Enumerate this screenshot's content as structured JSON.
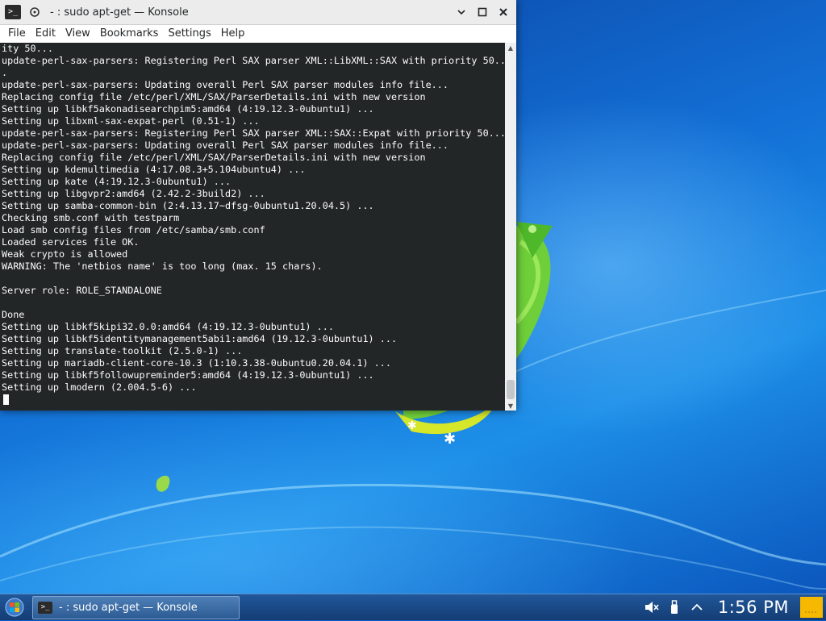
{
  "window": {
    "title": "- : sudo apt-get — Konsole",
    "app_icon_glyph": ">_",
    "menu": [
      "File",
      "Edit",
      "View",
      "Bookmarks",
      "Settings",
      "Help"
    ]
  },
  "terminal": {
    "lines": [
      "ity 50...",
      "update-perl-sax-parsers: Registering Perl SAX parser XML::LibXML::SAX with priority 50..",
      ".",
      "update-perl-sax-parsers: Updating overall Perl SAX parser modules info file...",
      "Replacing config file /etc/perl/XML/SAX/ParserDetails.ini with new version",
      "Setting up libkf5akonadisearchpim5:amd64 (4:19.12.3-0ubuntu1) ...",
      "Setting up libxml-sax-expat-perl (0.51-1) ...",
      "update-perl-sax-parsers: Registering Perl SAX parser XML::SAX::Expat with priority 50...",
      "update-perl-sax-parsers: Updating overall Perl SAX parser modules info file...",
      "Replacing config file /etc/perl/XML/SAX/ParserDetails.ini with new version",
      "Setting up kdemultimedia (4:17.08.3+5.104ubuntu4) ...",
      "Setting up kate (4:19.12.3-0ubuntu1) ...",
      "Setting up libgvpr2:amd64 (2.42.2-3build2) ...",
      "Setting up samba-common-bin (2:4.13.17~dfsg-0ubuntu1.20.04.5) ...",
      "Checking smb.conf with testparm",
      "Load smb config files from /etc/samba/smb.conf",
      "Loaded services file OK.",
      "Weak crypto is allowed",
      "WARNING: The 'netbios name' is too long (max. 15 chars).",
      "",
      "Server role: ROLE_STANDALONE",
      "",
      "Done",
      "Setting up libkf5kipi32.0.0:amd64 (4:19.12.3-0ubuntu1) ...",
      "Setting up libkf5identitymanagement5abi1:amd64 (19.12.3-0ubuntu1) ...",
      "Setting up translate-toolkit (2.5.0-1) ...",
      "Setting up mariadb-client-core-10.3 (1:10.3.38-0ubuntu0.20.04.1) ...",
      "Setting up libkf5followupreminder5:amd64 (4:19.12.3-0ubuntu1) ...",
      "Setting up lmodern (2.004.5-6) ..."
    ]
  },
  "taskbar": {
    "task_label": "- : sudo apt-get — Konsole",
    "clock": "1:56 PM"
  },
  "colors": {
    "terminal_bg": "#232627",
    "terminal_fg": "#fcfcfc",
    "titlebar_bg": "#ececec",
    "taskbar_bg": "#1c4a86",
    "notes_yellow": "#f6b800"
  }
}
